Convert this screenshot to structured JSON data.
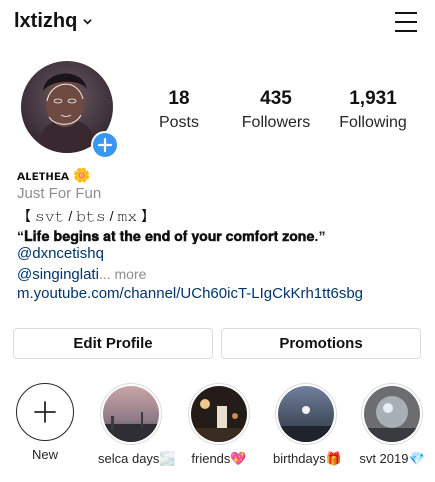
{
  "header": {
    "username": "lxtizhq"
  },
  "stats": [
    {
      "value": "18",
      "label": "Posts"
    },
    {
      "value": "435",
      "label": "Followers"
    },
    {
      "value": "1,931",
      "label": "Following"
    }
  ],
  "bio": {
    "name": "ᴀʟᴇᴛʜᴇᴀ 🌼",
    "category": "Just For Fun",
    "line1": "【 𝚜𝚟𝚝 / 𝚋𝚝𝚜 / 𝚖𝚡 】",
    "line2": "“𝐋𝐢𝐟𝐞 𝐛𝐞𝐠𝐢𝐧𝐬 𝐚𝐭 𝐭𝐡𝐞 𝐞𝐧𝐝 𝐨𝐟 𝐲𝐨𝐮𝐫 𝐜𝐨𝐦𝐟𝐨𝐫𝐭 𝐳𝐨𝐧𝐞.”",
    "mention1": "@dxncetishq",
    "mention2": "@singinglati",
    "more": "... more",
    "website": "m.youtube.com/channel/UCh60icT-LIgCkKrh1tt6sbg"
  },
  "buttons": {
    "edit": "Edit Profile",
    "promotions": "Promotions"
  },
  "highlights": [
    {
      "label": "New"
    },
    {
      "label": "selca days🌫️"
    },
    {
      "label": "friends💖"
    },
    {
      "label": "birthdays🎁"
    },
    {
      "label": "svt 2019💎"
    }
  ],
  "colors": {
    "accent": "#3897f0",
    "link": "#003569",
    "muted": "#8e8e8e",
    "border": "#dbdbdb"
  }
}
